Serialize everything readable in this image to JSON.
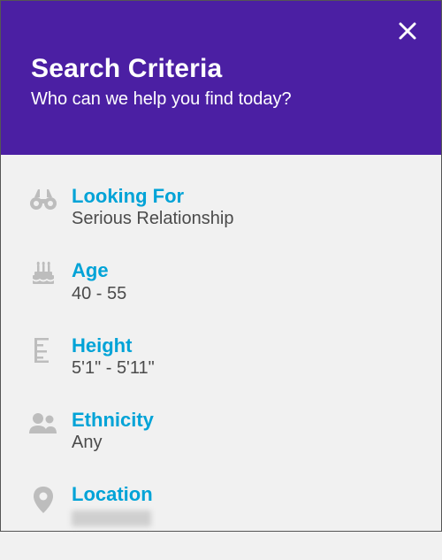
{
  "header": {
    "title": "Search Criteria",
    "subtitle": "Who can we help you find today?"
  },
  "colors": {
    "header_bg": "#4b1fa3",
    "accent": "#00a3d7",
    "icon": "#bdbdbd",
    "body_bg": "#f1f1f1",
    "value_text": "#4b4b4b"
  },
  "criteria": [
    {
      "key": "looking_for",
      "label": "Looking For",
      "value": "Serious Relationship",
      "icon": "binoculars-icon"
    },
    {
      "key": "age",
      "label": "Age",
      "value": "40 - 55",
      "icon": "birthday-cake-icon"
    },
    {
      "key": "height",
      "label": "Height",
      "value": "5'1\" - 5'11\"",
      "icon": "ruler-icon"
    },
    {
      "key": "ethnicity",
      "label": "Ethnicity",
      "value": "Any",
      "icon": "people-icon"
    },
    {
      "key": "location",
      "label": "Location",
      "value": "",
      "icon": "location-pin-icon",
      "redacted": true
    }
  ]
}
